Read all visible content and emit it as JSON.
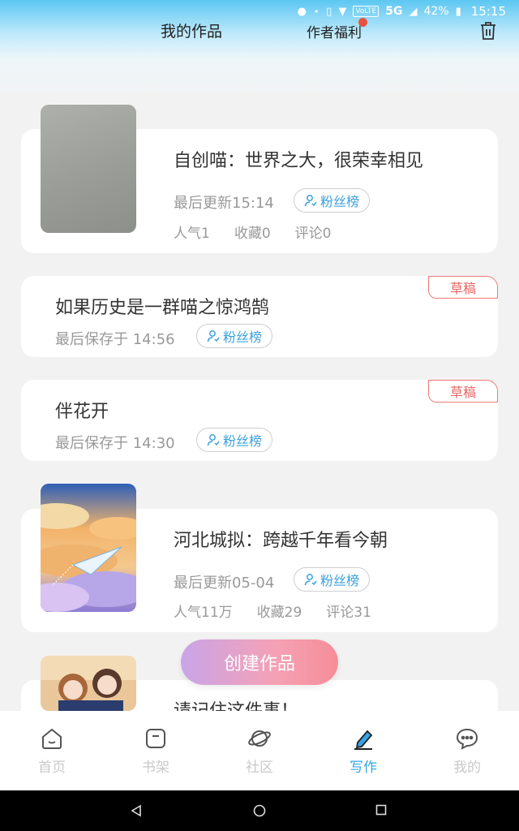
{
  "status_bar": {
    "network": "5G",
    "volte": "VoLTE",
    "battery": "42%",
    "time": "15:15"
  },
  "header": {
    "tab_works": "我的作品",
    "tab_welfare": "作者福利",
    "trash_icon": "trash-icon"
  },
  "fans_label": "粉丝榜",
  "works": [
    {
      "title": "自创喵：世界之大，很荣幸相见",
      "updated": "最后更新15:14",
      "popularity": "人气1",
      "favorites": "收藏0",
      "comments": "评论0"
    },
    {
      "title": "如果历史是一群喵之惊鸿鹄",
      "saved": "最后保存于 14:56",
      "tag": "草稿"
    },
    {
      "title": "伴花开",
      "saved": "最后保存于 14:30",
      "tag": "草稿"
    },
    {
      "title": "河北城拟：跨越千年看今朝",
      "updated": "最后更新05-04",
      "popularity": "人气11万",
      "favorites": "收藏29",
      "comments": "评论31"
    },
    {
      "title": "请记住这件事！"
    }
  ],
  "create_button": "创建作品",
  "bottom_nav": [
    {
      "label": "首页",
      "icon": "home-icon"
    },
    {
      "label": "书架",
      "icon": "bookshelf-icon"
    },
    {
      "label": "社区",
      "icon": "planet-icon"
    },
    {
      "label": "写作",
      "icon": "write-icon",
      "active": true
    },
    {
      "label": "我的",
      "icon": "chat-icon"
    }
  ],
  "colors": {
    "accent": "#35a6e8",
    "draft": "#e96565",
    "inactive": "#c9c9c9"
  }
}
